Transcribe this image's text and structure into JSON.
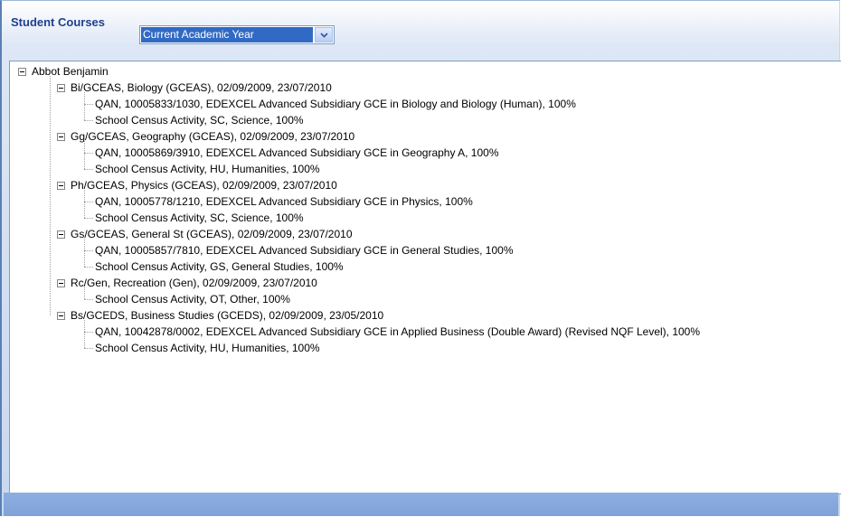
{
  "header": {
    "title": "Student Courses",
    "year_filter": {
      "selected": "Current Academic Year"
    }
  },
  "tree": {
    "root": "Abbot Benjamin",
    "courses": [
      {
        "label": "Bi/GCEAS, Biology (GCEAS), 02/09/2009, 23/07/2010",
        "children": [
          "QAN, 10005833/1030, EDEXCEL Advanced Subsidiary GCE in Biology and Biology (Human), 100%",
          "School Census Activity, SC, Science, 100%"
        ]
      },
      {
        "label": "Gg/GCEAS, Geography (GCEAS), 02/09/2009, 23/07/2010",
        "children": [
          "QAN, 10005869/3910, EDEXCEL Advanced Subsidiary GCE in Geography A, 100%",
          "School Census Activity, HU, Humanities, 100%"
        ]
      },
      {
        "label": "Ph/GCEAS, Physics (GCEAS), 02/09/2009, 23/07/2010",
        "children": [
          "QAN, 10005778/1210, EDEXCEL Advanced Subsidiary GCE in Physics, 100%",
          "School Census Activity, SC, Science, 100%"
        ]
      },
      {
        "label": "Gs/GCEAS, General St (GCEAS), 02/09/2009, 23/07/2010",
        "children": [
          "QAN, 10005857/7810, EDEXCEL Advanced Subsidiary GCE in General Studies, 100%",
          "School Census Activity, GS, General Studies, 100%"
        ]
      },
      {
        "label": "Rc/Gen, Recreation (Gen), 02/09/2009, 23/07/2010",
        "children": [
          "School Census Activity, OT, Other, 100%"
        ]
      },
      {
        "label": "Bs/GCEDS, Business Studies (GCEDS), 02/09/2009, 23/05/2010",
        "children": [
          "QAN, 10042878/0002, EDEXCEL Advanced Subsidiary GCE in Applied Business (Double Award) (Revised NQF Level), 100%",
          "School Census Activity, HU, Humanities, 100%"
        ]
      }
    ]
  }
}
